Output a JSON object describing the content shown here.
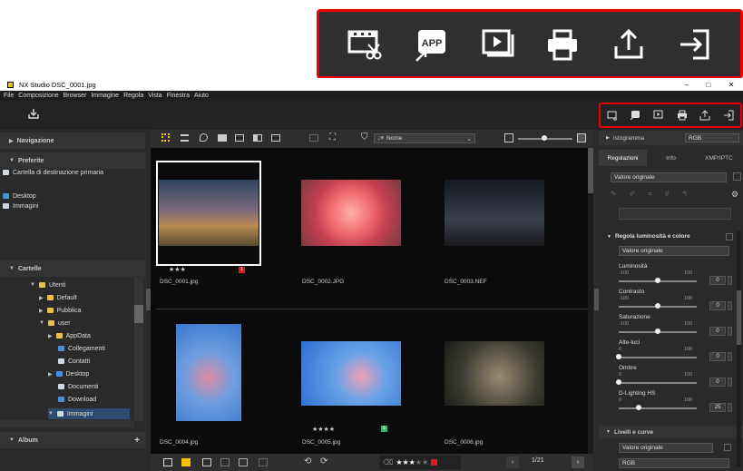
{
  "window": {
    "title": "NX Studio   DSC_0001.jpg"
  },
  "menu": [
    "File",
    "Composizione",
    "Browser",
    "Immagine",
    "Regola",
    "Vista",
    "Finestra",
    "Aiuto"
  ],
  "window_controls": [
    "–",
    "□",
    "✕"
  ],
  "toolbar": {
    "import_icon": "import-icon"
  },
  "left_panel": {
    "navigation": "Navigazione",
    "favorites": "Preferite",
    "favorites_items": [
      "Cartella di destinazione primaria",
      "Desktop",
      "Immagini"
    ],
    "folders": "Cartelle",
    "tree": [
      "Utenti",
      "Default",
      "Pubblica",
      "user",
      "AppData",
      "Collegamenti",
      "Contatti",
      "Desktop",
      "Documenti",
      "Download",
      "Immagini"
    ],
    "album": "Album",
    "album_add": "+"
  },
  "center": {
    "sort": "Nome",
    "sort_prefix": "↓≡",
    "thumbnails": [
      {
        "name": "DSC_0001.jpg",
        "rating": "★★★",
        "label_color": "#e01b24",
        "label_text": "1"
      },
      {
        "name": "DSC_0002.JPG",
        "rating": "",
        "label_color": "",
        "label_text": ""
      },
      {
        "name": "DSC_0003.NEF",
        "rating": "",
        "label_color": "",
        "label_text": ""
      },
      {
        "name": "DSC_0004.jpg",
        "rating": "",
        "label_color": "",
        "label_text": ""
      },
      {
        "name": "DSC_0005.jpg",
        "rating": "★★★★",
        "label_color": "#3cb371",
        "label_text": "6"
      },
      {
        "name": "DSC_0006.jpg",
        "rating": "",
        "label_color": "",
        "label_text": ""
      }
    ],
    "bottom_rating": "★★★",
    "bottom_rating_empty": "★★",
    "page": "1/21"
  },
  "right_panel": {
    "histogram": "Istogramma",
    "histogram_channel": "RGB",
    "tabs": [
      "Regolazioni",
      "Info",
      "XMP/IPTC"
    ],
    "preset": "Valore originale",
    "section1": "Regola luminosità e colore",
    "section1_preset": "Valore originale",
    "sliders": [
      {
        "label": "Luminosità",
        "min": "-100",
        "max": "100",
        "value": "0",
        "level": 0.5
      },
      {
        "label": "Contrasto",
        "min": "-100",
        "max": "100",
        "value": "0",
        "level": 0.5
      },
      {
        "label": "Saturazione",
        "min": "-100",
        "max": "100",
        "value": "0",
        "level": 0.5
      },
      {
        "label": "Alte-luci",
        "min": "0",
        "max": "100",
        "value": "0",
        "level": 0
      },
      {
        "label": "Ombre",
        "min": "0",
        "max": "100",
        "value": "0",
        "level": 0
      },
      {
        "label": "D-Lighting HS",
        "min": "0",
        "max": "100",
        "value": "25",
        "level": 0.25
      }
    ],
    "section2": "Livelli e curve",
    "section2_preset": "Valore originale",
    "section2_channel": "RGB"
  },
  "colors": {
    "callout": "#e00000",
    "accent": "#f5c400"
  }
}
